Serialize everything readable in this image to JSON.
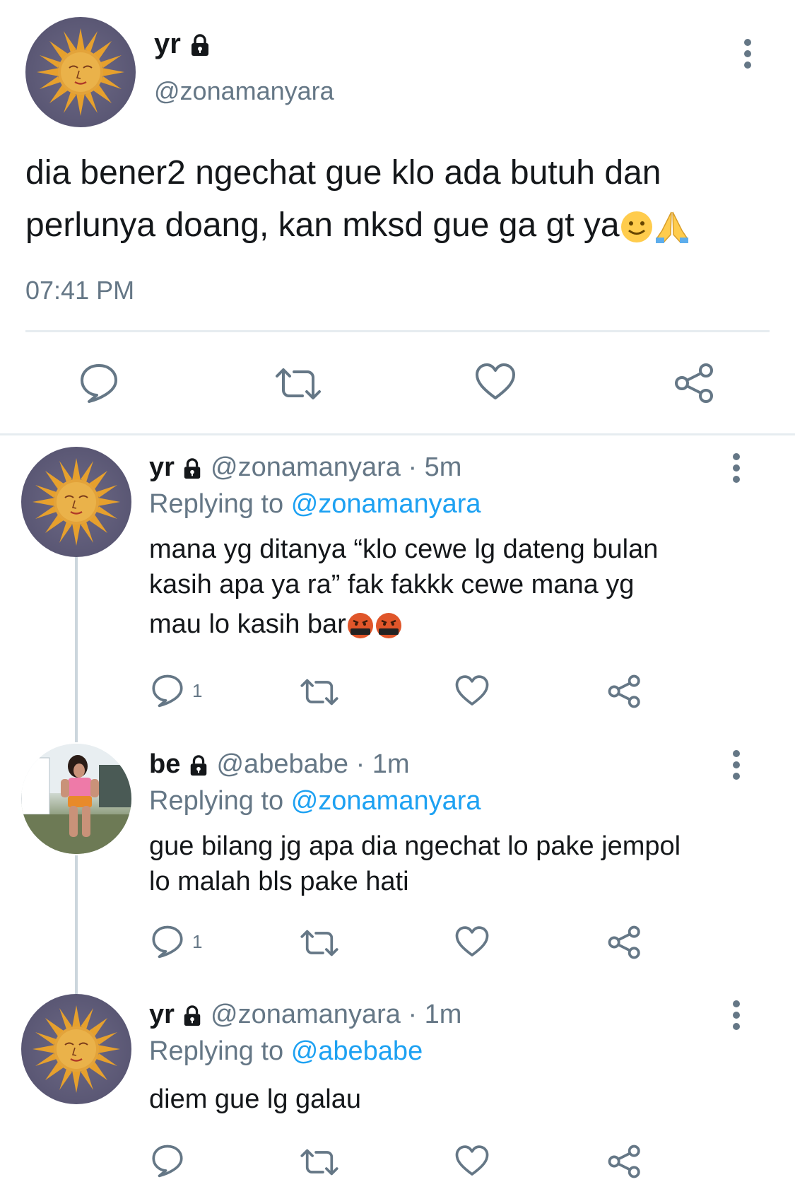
{
  "main_tweet": {
    "display_name": "yr",
    "handle": "@zonamanyara",
    "text_line1": "dia bener2 ngechat gue klo ada butuh dan",
    "text_line2": "perlunya doang, kan mksd gue ga gt ya",
    "time": "07:41 PM",
    "icons": [
      "reply-icon",
      "retweet-icon",
      "like-icon",
      "share-icon"
    ]
  },
  "replies": [
    {
      "display_name": "yr",
      "handle": "@zonamanyara",
      "age": "· 5m",
      "replying_prefix": "Replying to",
      "replying_to": "@zonamanyara",
      "lines": [
        "mana yg ditanya “klo cewe lg dateng bulan",
        "kasih apa ya ra” fak fakkk cewe mana yg",
        "mau lo kasih bar"
      ],
      "reply_count": "1"
    },
    {
      "display_name": "be",
      "handle": "@abebabe",
      "age": "· 1m",
      "replying_prefix": "Replying to",
      "replying_to": "@zonamanyara",
      "lines": [
        "gue bilang jg apa dia ngechat lo pake jempol",
        "lo malah bls pake hati"
      ],
      "reply_count": "1"
    },
    {
      "display_name": "yr",
      "handle": "@zonamanyara",
      "age": "· 1m",
      "replying_prefix": "Replying to",
      "replying_to": "@abebabe",
      "lines": [
        "diem gue lg galau"
      ],
      "reply_count": ""
    }
  ],
  "colors": {
    "text": "#14171a",
    "secondary": "#657786",
    "link": "#1da1f2",
    "divider": "#e6ecf0"
  }
}
